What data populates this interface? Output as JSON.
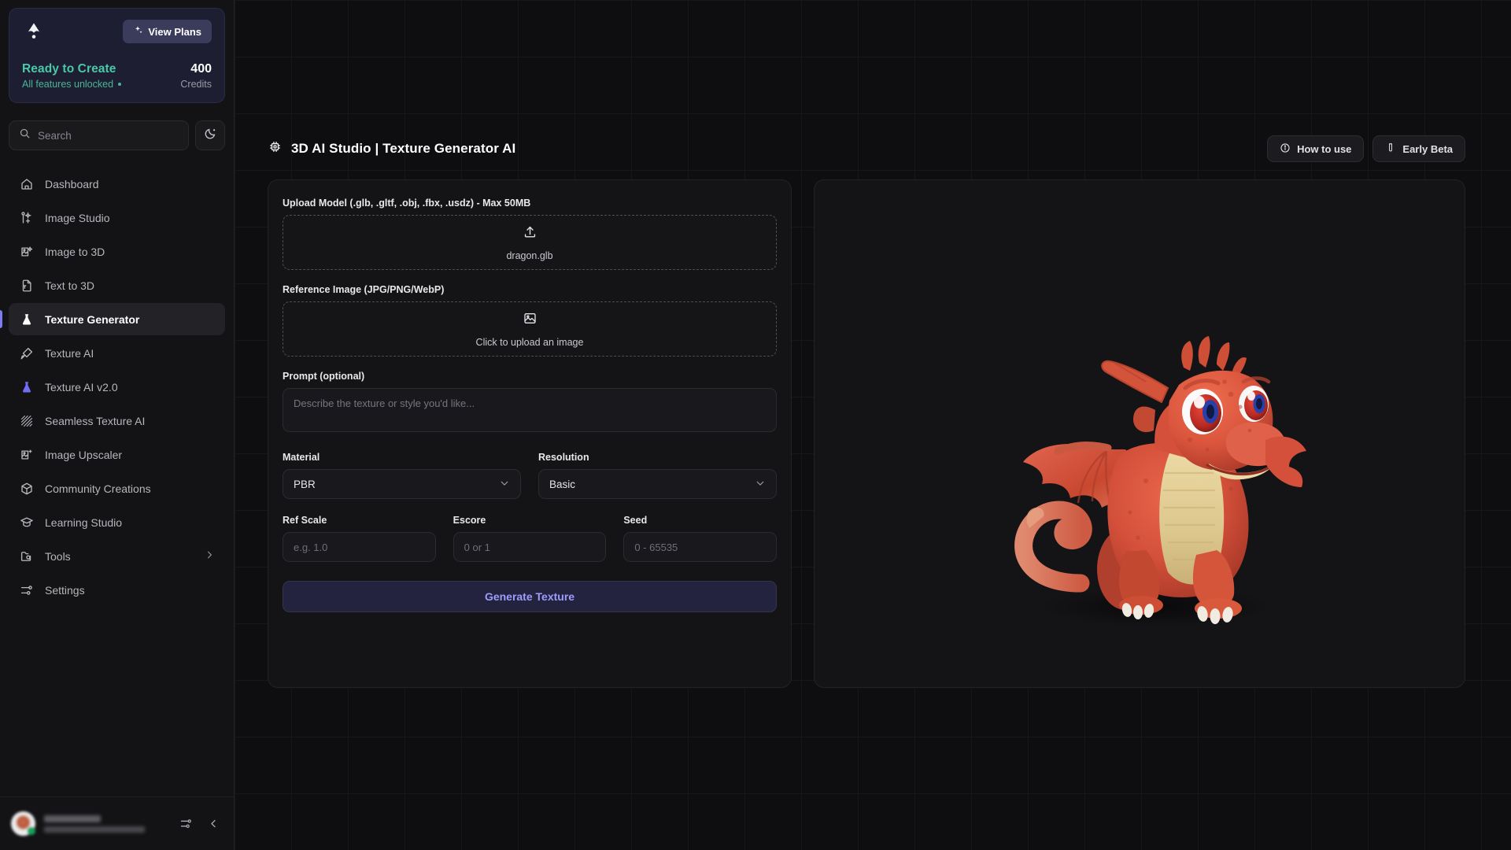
{
  "sidebar": {
    "brand_icon": "app-logo-icon",
    "plans_button": {
      "label": "View Plans",
      "icon": "sparkles-icon"
    },
    "credits": {
      "status_title": "Ready to Create",
      "status_sub": "All features unlocked",
      "amount": "400",
      "amount_label": "Credits"
    },
    "search": {
      "placeholder": "Search",
      "icon": "search-icon"
    },
    "theme_toggle_icon": "moon-sparkle-icon",
    "items": [
      {
        "label": "Dashboard",
        "icon": "home-icon",
        "active": false
      },
      {
        "label": "Image Studio",
        "icon": "image-studio-icon",
        "active": false
      },
      {
        "label": "Image to 3D",
        "icon": "image-3d-icon",
        "active": false
      },
      {
        "label": "Text to 3D",
        "icon": "file-text-3d-icon",
        "active": false
      },
      {
        "label": "Texture Generator",
        "icon": "flask-icon",
        "active": true
      },
      {
        "label": "Texture AI",
        "icon": "paint-brush-icon",
        "active": false
      },
      {
        "label": "Texture AI v2.0",
        "icon": "flask-accent-icon",
        "active": false
      },
      {
        "label": "Seamless Texture AI",
        "icon": "hatch-pattern-icon",
        "active": false
      },
      {
        "label": "Image Upscaler",
        "icon": "image-sparkle-icon",
        "active": false
      },
      {
        "label": "Community Creations",
        "icon": "cube-icon",
        "active": false
      },
      {
        "label": "Learning Studio",
        "icon": "graduation-cap-icon",
        "active": false
      },
      {
        "label": "Tools",
        "icon": "folder-search-icon",
        "active": false,
        "chevron": "chevron-right-icon"
      },
      {
        "label": "Settings",
        "icon": "sliders-icon",
        "active": false
      }
    ],
    "footer": {
      "avatar_icon": "user-avatar",
      "user_name": "",
      "user_email": "",
      "settings_icon": "sliders-icon",
      "collapse_icon": "chevron-left-icon"
    }
  },
  "header": {
    "icon": "cpu-chip-icon",
    "title": "3D AI Studio | Texture Generator AI",
    "actions": [
      {
        "label": "How to use",
        "icon": "info-circle-icon"
      },
      {
        "label": "Early Beta",
        "icon": "test-tube-icon"
      }
    ]
  },
  "form": {
    "upload_model": {
      "label": "Upload Model (.glb, .gltf, .obj, .fbx, .usdz) - Max 50MB",
      "icon": "upload-icon",
      "filename": "dragon.glb"
    },
    "reference_image": {
      "label": "Reference Image (JPG/PNG/WebP)",
      "icon": "image-placeholder-icon",
      "hint": "Click to upload an image"
    },
    "prompt": {
      "label": "Prompt (optional)",
      "placeholder": "Describe the texture or style you'd like...",
      "value": ""
    },
    "material": {
      "label": "Material",
      "value": "PBR",
      "chevron": "chevron-down-icon"
    },
    "resolution": {
      "label": "Resolution",
      "value": "Basic",
      "chevron": "chevron-down-icon"
    },
    "ref_scale": {
      "label": "Ref Scale",
      "placeholder": "e.g. 1.0",
      "value": ""
    },
    "escore": {
      "label": "Escore",
      "placeholder": "0 or 1",
      "value": ""
    },
    "seed": {
      "label": "Seed",
      "placeholder": "0 - 65535",
      "value": ""
    },
    "generate_button": "Generate Texture"
  },
  "preview": {
    "model_name": "dragon.glb",
    "subject": "cartoon red dragon 3D model"
  },
  "colors": {
    "accent": "#7c7cf0",
    "credit_green": "#49c9a7",
    "generate_text": "#9d9dfa",
    "card_bg": "#1e1e33",
    "dragon_body": "#d8503c",
    "dragon_belly": "#e3cf9a"
  }
}
